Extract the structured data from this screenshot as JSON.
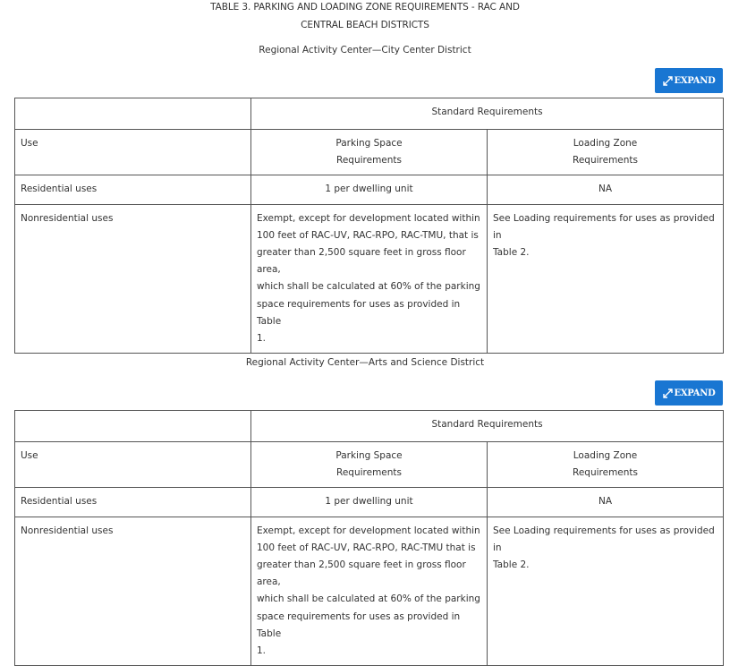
{
  "document": {
    "title_line1": "TABLE 3. PARKING AND LOADING ZONE REQUIREMENTS - RAC AND",
    "title_line2": "CENTRAL BEACH DISTRICTS"
  },
  "expand_label": "EXPAND",
  "tables": [
    {
      "caption": "Regional Activity Center—City Center District",
      "group_header": "Standard Requirements",
      "col_use": "Use",
      "col_parking_line1": "Parking Space",
      "col_parking_line2": "Requirements",
      "col_loading_line1": "Loading Zone",
      "col_loading_line2": "Requirements",
      "rows": [
        {
          "use": "Residential uses",
          "parking": "1 per dwelling unit",
          "loading": "NA"
        },
        {
          "use": "Nonresidential uses",
          "parking_lines": [
            "Exempt, except for development located within",
            "100 feet of RAC-UV, RAC-RPO, RAC-TMU, that is",
            "greater than 2,500 square feet in gross floor area,",
            "which shall be calculated at 60% of the parking",
            "space requirements for uses as provided in Table",
            "1."
          ],
          "loading_lines": [
            "See Loading requirements for uses as provided in",
            "Table 2."
          ]
        }
      ]
    },
    {
      "caption": "Regional Activity Center—Arts and Science District",
      "group_header": "Standard Requirements",
      "col_use": "Use",
      "col_parking_line1": "Parking Space",
      "col_parking_line2": "Requirements",
      "col_loading_line1": "Loading Zone",
      "col_loading_line2": "Requirements",
      "rows": [
        {
          "use": "Residential uses",
          "parking": "1 per dwelling unit",
          "loading": "NA"
        },
        {
          "use": "Nonresidential uses",
          "parking_lines": [
            "Exempt, except for development located within",
            "100 feet of RAC-UV, RAC-RPO, RAC-TMU that is",
            "greater than 2,500 square feet in gross floor area,",
            "which shall be calculated at 60% of the parking",
            "space requirements for uses as provided in Table",
            "1."
          ],
          "loading_lines": [
            "See Loading requirements for uses as provided in",
            "Table 2."
          ]
        }
      ]
    }
  ],
  "colors": {
    "button_bg": "#1976d2",
    "button_text": "#ffffff",
    "border": "#555555",
    "text": "#333333"
  },
  "icons": {
    "expand": "expand-arrows-icon"
  }
}
